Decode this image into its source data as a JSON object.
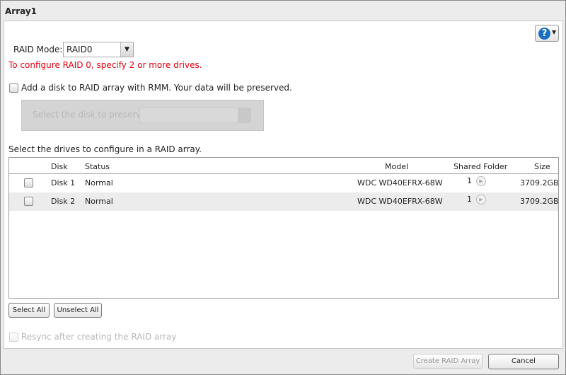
{
  "window": {
    "title": "Array1"
  },
  "help": {
    "icon": "help-icon",
    "label": "?"
  },
  "raid_mode": {
    "label": "RAID Mode:",
    "value": "RAID0"
  },
  "warning": "To configure RAID 0, specify 2 or more drives.",
  "rmm": {
    "label": "Add a disk to RAID array with RMM. Your data will be preserved.",
    "preserve_label": "Select the disk to preserve:",
    "preserve_value": ""
  },
  "drives_label": "Select the drives to configure in a RAID array.",
  "table": {
    "headers": [
      "Disk",
      "Status",
      "Model",
      "Shared Folder",
      "Size"
    ],
    "rows": [
      {
        "disk": "Disk 1",
        "status": "Normal",
        "model": "WDC WD40EFRX-68W",
        "shared": "1",
        "size": "3709.2GB"
      },
      {
        "disk": "Disk 2",
        "status": "Normal",
        "model": "WDC WD40EFRX-68W",
        "shared": "1",
        "size": "3709.2GB"
      }
    ]
  },
  "buttons": {
    "select_all": "Select All",
    "unselect_all": "Unselect All",
    "create": "Create RAID Array",
    "cancel": "Cancel"
  },
  "resync": "Resync after creating the RAID array",
  "colors": {
    "warning": "#e0000f",
    "help": "#1a6ec4"
  }
}
